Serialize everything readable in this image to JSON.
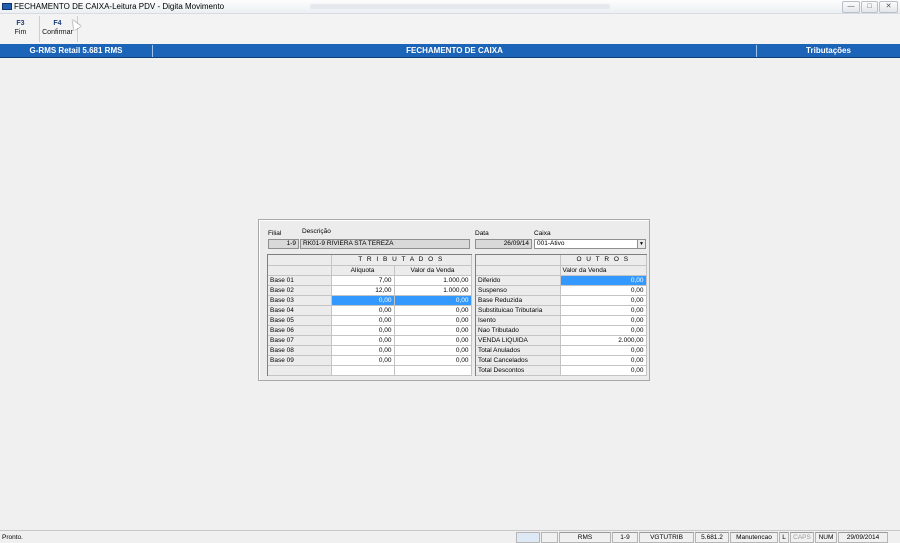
{
  "window": {
    "title": "FECHAMENTO DE CAIXA-Leitura PDV - Digita Movimento",
    "controls": [
      "minimize",
      "maximize",
      "close"
    ]
  },
  "toolbar": {
    "buttons": [
      {
        "key": "F3",
        "label": "Fim"
      },
      {
        "key": "F4",
        "label": "Confirmar"
      }
    ]
  },
  "header": {
    "left": "G-RMS Retail 5.681 RMS",
    "center": "FECHAMENTO DE CAIXA",
    "right": "Tributações"
  },
  "form": {
    "filial_label": "Filial",
    "filial_value": "1-9",
    "descricao_label": "Descrição",
    "descricao_value": "RK01-9 RIVIERA STA TEREZA",
    "data_label": "Data",
    "data_value": "26/09/14",
    "caixa_label": "Caixa",
    "caixa_value": "001-Ativo"
  },
  "tributados": {
    "title": "T R I B U T A D O S",
    "columns": [
      "Alíquota",
      "Valor da Venda"
    ],
    "rows": [
      {
        "label": "Base 01",
        "aliquota": "7,00",
        "valor": "1.000,00"
      },
      {
        "label": "Base 02",
        "aliquota": "12,00",
        "valor": "1.000,00"
      },
      {
        "label": "Base 03",
        "aliquota": "0,00",
        "valor": "0,00"
      },
      {
        "label": "Base 04",
        "aliquota": "0,00",
        "valor": "0,00"
      },
      {
        "label": "Base 05",
        "aliquota": "0,00",
        "valor": "0,00"
      },
      {
        "label": "Base 06",
        "aliquota": "0,00",
        "valor": "0,00"
      },
      {
        "label": "Base 07",
        "aliquota": "0,00",
        "valor": "0,00"
      },
      {
        "label": "Base 08",
        "aliquota": "0,00",
        "valor": "0,00"
      },
      {
        "label": "Base 09",
        "aliquota": "0,00",
        "valor": "0,00"
      }
    ]
  },
  "outros": {
    "title": "O U T R O S",
    "column": "Valor da Venda",
    "rows": [
      {
        "label": "Diferido",
        "valor": "0,00"
      },
      {
        "label": "Suspenso",
        "valor": "0,00"
      },
      {
        "label": "Base Reduzida",
        "valor": "0,00"
      },
      {
        "label": "Substituicao Tributaria",
        "valor": "0,00"
      },
      {
        "label": "Isento",
        "valor": "0,00"
      },
      {
        "label": "Nao Tributado",
        "valor": "0,00"
      },
      {
        "label": "VENDA LIQUIDA",
        "valor": "2.000,00"
      },
      {
        "label": "Total Anulados",
        "valor": "0,00"
      },
      {
        "label": "Total Cancelados",
        "valor": "0,00"
      },
      {
        "label": "Total Descontos",
        "valor": "0,00"
      }
    ]
  },
  "statusbar": {
    "message": "Pronto.",
    "cells": [
      "RMS",
      "1-9",
      "VGTUTRIB",
      "5.681.2",
      "Manutencao",
      "L",
      "CAPS",
      "NUM",
      "29/09/2014"
    ]
  },
  "colors": {
    "header_bar": "#1b64b8",
    "selection": "#3399ff"
  }
}
